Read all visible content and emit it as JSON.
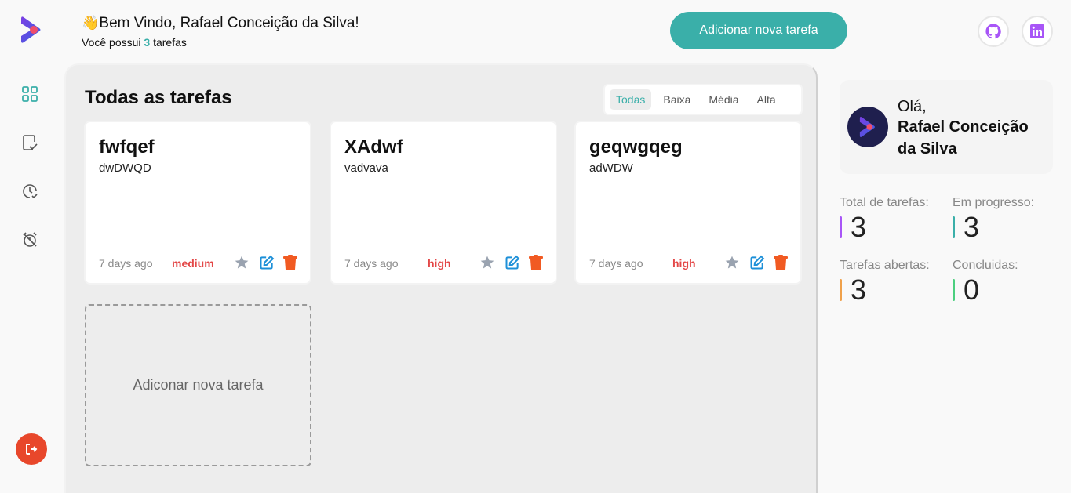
{
  "header": {
    "greeting_emoji": "👋",
    "greeting": "Bem Vindo, Rafael Conceição da Silva!",
    "sub_prefix": "Você possui",
    "task_count": "3",
    "sub_suffix": "tarefas",
    "add_button": "Adicionar nova tarefa"
  },
  "sidebar": {
    "items": [
      {
        "icon": "grid-icon",
        "active": true
      },
      {
        "icon": "task-check-icon",
        "active": false
      },
      {
        "icon": "clock-check-icon",
        "active": false
      },
      {
        "icon": "alarm-off-icon",
        "active": false
      }
    ],
    "logout_icon": "logout-icon"
  },
  "social": [
    "github-icon",
    "linkedin-icon"
  ],
  "main": {
    "title": "Todas as tarefas",
    "filters": [
      "Todas",
      "Baixa",
      "Média",
      "Alta"
    ],
    "active_filter": "Todas",
    "tasks": [
      {
        "title": "fwfqef",
        "description": "dwDWQD",
        "date": "7 days ago",
        "priority": "medium"
      },
      {
        "title": "XAdwf",
        "description": "vadvava",
        "date": "7 days ago",
        "priority": "high"
      },
      {
        "title": "geqwgqeg",
        "description": "adWDW",
        "date": "7 days ago",
        "priority": "high"
      }
    ],
    "add_card_label": "Adiconar nova tarefa"
  },
  "profile": {
    "hello": "Olá,",
    "name": "Rafael Conceição da Silva"
  },
  "stats": [
    {
      "label": "Total de tarefas:",
      "value": "3",
      "color": "#a855f7"
    },
    {
      "label": "Em progresso:",
      "value": "3",
      "color": "#3aafa9"
    },
    {
      "label": "Tarefas abertas:",
      "value": "3",
      "color": "#f0a14b"
    },
    {
      "label": "Concluidas:",
      "value": "0",
      "color": "#4ccf7f"
    }
  ],
  "colors": {
    "accent": "#3aafa9",
    "priority": "#e34848",
    "star": "#9aa3b0",
    "edit": "#1e90d8",
    "delete": "#f15a22",
    "logout": "#e8472b"
  }
}
